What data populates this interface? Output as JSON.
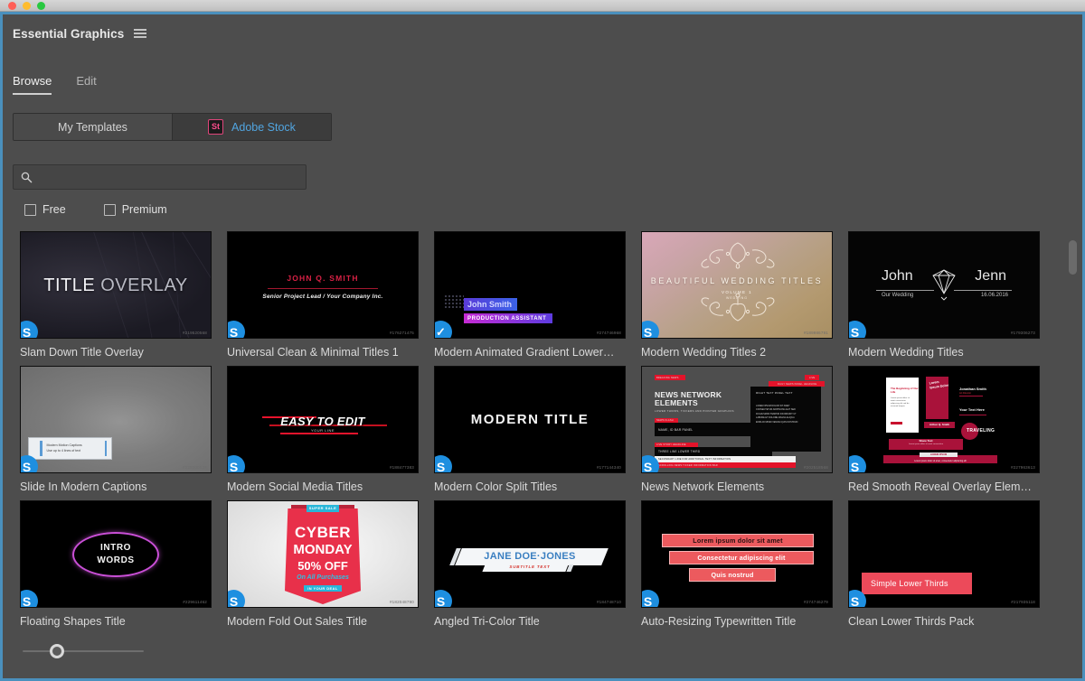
{
  "window": {
    "traffic_lights": [
      "close",
      "minimize",
      "maximize"
    ]
  },
  "panel": {
    "title": "Essential Graphics",
    "menu_icon": "hamburger-icon"
  },
  "tabs": [
    {
      "label": "Browse",
      "active": true
    },
    {
      "label": "Edit",
      "active": false
    }
  ],
  "source_toggle": [
    {
      "label": "My Templates",
      "active": false,
      "icon": null
    },
    {
      "label": "Adobe Stock",
      "active": true,
      "icon": "St"
    }
  ],
  "search": {
    "placeholder": "",
    "value": "",
    "icon": "search-icon"
  },
  "filters": [
    {
      "label": "Free",
      "checked": false
    },
    {
      "label": "Premium",
      "checked": false
    }
  ],
  "zoom_slider": {
    "value": 22,
    "min": 0,
    "max": 100
  },
  "scrollbar": {
    "thumb_position": "top"
  },
  "templates": [
    {
      "title": "Slam Down Title Overlay",
      "badge": "premium",
      "stock_id": "#219520568",
      "art": "slam",
      "text": {
        "line1": "TITLE ",
        "line2": "OVERLAY"
      }
    },
    {
      "title": "Universal Clean & Minimal Titles 1",
      "badge": "premium",
      "stock_id": "#176271475",
      "art": "universal",
      "text": {
        "name": "JOHN Q. SMITH",
        "subtitle": "Senior Project Lead / Your Company Inc."
      }
    },
    {
      "title": "Modern Animated Gradient Lower…",
      "badge": "licensed",
      "stock_id": "#274746968",
      "art": "gradient",
      "text": {
        "name": "John Smith",
        "role": "PRODUCTION ASSISTANT"
      }
    },
    {
      "title": "Modern Wedding Titles 2",
      "badge": "premium",
      "stock_id": "#189986791",
      "art": "wedding2",
      "text": {
        "heading": "BEAUTIFUL WEDDING TITLES",
        "volume": "VOLUME 1",
        "sub": "WEDDING"
      }
    },
    {
      "title": "Modern Wedding Titles",
      "badge": "premium",
      "stock_id": "#179306273",
      "art": "wedding1",
      "text": {
        "left": "John",
        "right": "Jenn",
        "left_sub": "Our Wedding",
        "right_sub": "16.06.2016"
      }
    },
    {
      "title": "Slide In Modern Captions",
      "badge": "premium",
      "stock_id": "#228300528",
      "art": "slide",
      "text": {
        "line1": "Modern Motion Captions",
        "line2": "Use up to 4 lines of text"
      }
    },
    {
      "title": "Modern Social Media Titles",
      "badge": "premium",
      "stock_id": "#188477383",
      "art": "social",
      "text": {
        "headline": "EASY TO EDIT",
        "sub": "YOUR LINE"
      }
    },
    {
      "title": "Modern Color Split Titles",
      "badge": "premium",
      "stock_id": "#177144340",
      "art": "split",
      "text": {
        "headline": "MODERN TITLE"
      }
    },
    {
      "title": "News Network Elements",
      "badge": "premium",
      "stock_id": "#202518568",
      "art": "news",
      "text": {
        "tag": "BREAKING NEWS",
        "headline1": "NEWS NETWORK",
        "headline2": "ELEMENTS",
        "sub": "LOWER THIRDS, TICKERS AND POINTER GRAPHICS",
        "panel_tag": "NEWS FLASH",
        "panel_text": "NAME, ID BAR PANEL",
        "ticker_tag": "LIVE  STORY HEADLINE",
        "ticker1": "THREE LINE LOWER THIRD",
        "ticker2": "SECONDARY LINE FOR ADDITIONAL TEXT INFORMATION",
        "ticker3": "SCROLLING NEWS TICKER INFORMATION BAR",
        "side_tag": "LIVE",
        "side_head": "DAILY NEWS PANEL HEADLINE",
        "side_title": "RIGHT  TEXT  PANEL  TEXT"
      }
    },
    {
      "title": "Red Smooth Reveal Overlay Elem…",
      "badge": "premium",
      "stock_id": "#227963613",
      "art": "red",
      "text": {
        "card_title": "The Beginning of Our Life",
        "vertical": "Lorem Ipsum Dolor",
        "name1": "Jonathan Smith",
        "name1_sub": "Art Director",
        "name2": "Your Text Here",
        "pill": "Arthur Q. Smith",
        "brand": "TRAVELING",
        "lt1_head": "Share Text",
        "lt2_head": "LOREM IPSUM",
        "lt2_sub": "Lorem ipsum dolor sit amet, consectetur adipiscing elit"
      }
    },
    {
      "title": "Floating Shapes Title",
      "badge": "premium",
      "stock_id": "#229611462",
      "art": "float",
      "text": {
        "line1": "INTRO",
        "line2": "WORDS"
      }
    },
    {
      "title": "Modern Fold Out Sales Title",
      "badge": "premium",
      "stock_id": "#182048790",
      "art": "cyber",
      "text": {
        "ribbon": "SUPER SALE",
        "line1": "CYBER",
        "line2": "MONDAY",
        "line3": "50% OFF",
        "line4": "On All Purchases",
        "line5": "IN YOUR DEAL"
      }
    },
    {
      "title": "Angled Tri-Color Title",
      "badge": "premium",
      "stock_id": "#184748710",
      "art": "angled",
      "text": {
        "name": "JANE DOE·JONES",
        "sub": "SUBTITLE TEXT"
      }
    },
    {
      "title": "Auto-Resizing Typewritten Title",
      "badge": "premium",
      "stock_id": "#274746279",
      "art": "typewritten",
      "text": {
        "row1": "Lorem ipsum dolor sit amet",
        "row2": "Consectetur adipiscing elit",
        "row3": "Quis nostrud"
      }
    },
    {
      "title": "Clean Lower Thirds Pack",
      "badge": "premium",
      "stock_id": "#217935118",
      "art": "clean",
      "text": {
        "bar": "Simple Lower Thirds"
      }
    }
  ],
  "colors": {
    "panel_bg": "#4d4d4d",
    "focus_border": "#4a90bd",
    "accent_blue": "#51a5e0",
    "badge_blue": "#1e8fe0",
    "stock_pink": "#e0457b",
    "news_red": "#e3132a"
  }
}
